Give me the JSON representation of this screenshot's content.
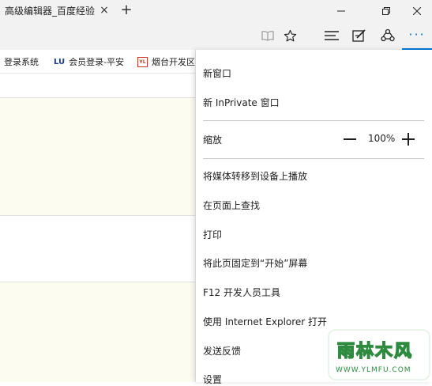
{
  "tab": {
    "title": "高级编辑器_百度经验",
    "close_glyph": "×",
    "new_glyph": "+"
  },
  "window": {
    "minimize": "minimize",
    "restore": "restore",
    "close": "close"
  },
  "toolbar": {
    "icons": [
      "reading-view-icon",
      "favorite-star-icon",
      "hub-icon",
      "web-note-icon",
      "share-icon",
      "more-icon"
    ]
  },
  "favorites": [
    {
      "label": "登录系统",
      "icon": "",
      "icon_color": "#c0392b"
    },
    {
      "label": "会员登录-平安",
      "icon": "LU",
      "icon_color": "#1a3d8f"
    },
    {
      "label": "烟台开发区",
      "icon": "YL",
      "icon_color": "#c0392b"
    }
  ],
  "menu": {
    "new_window": "新窗口",
    "new_inprivate": "新 InPrivate 窗口",
    "zoom_label": "缩放",
    "zoom_value": "100%",
    "cast": "将媒体转移到设备上播放",
    "find": "在页面上查找",
    "print": "打印",
    "pin_start": "将此页固定到“开始”屏幕",
    "devtools": "F12 开发人员工具",
    "open_ie": "使用 Internet Explorer 打开",
    "feedback": "发送反馈",
    "settings": "设置"
  },
  "watermark": {
    "main": "雨林木风",
    "sub": "WWW.YLMFU.COM"
  },
  "colors": {
    "accent": "#0078d7",
    "chrome": "#f2f2f2",
    "cream": "#fcfcf0"
  }
}
